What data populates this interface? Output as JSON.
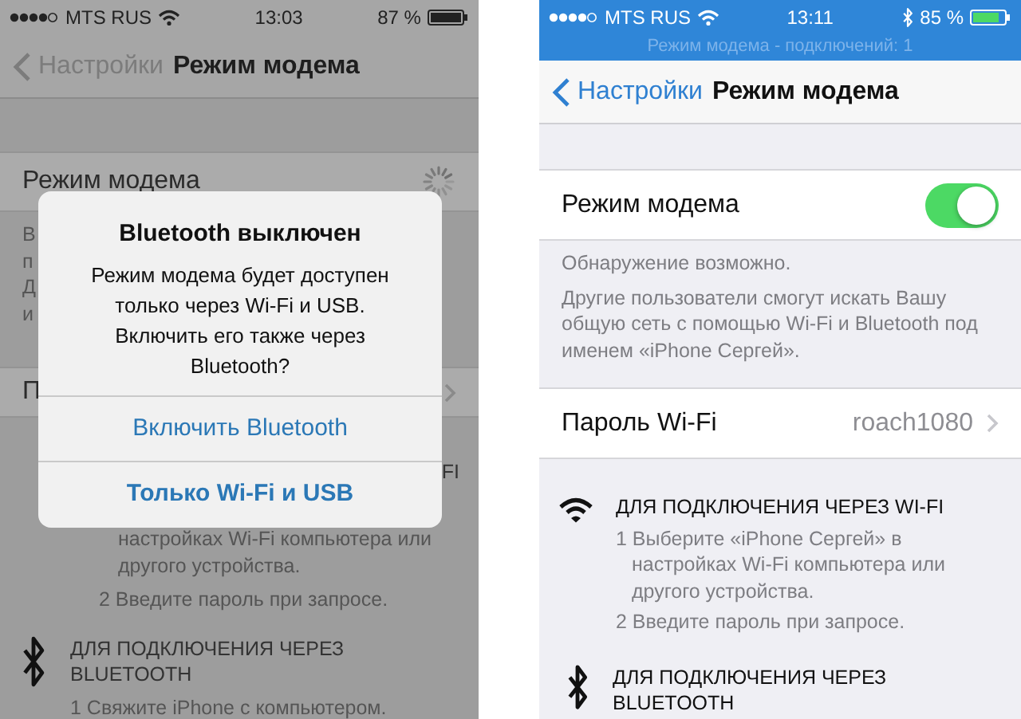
{
  "left_screen": {
    "status_bar": {
      "carrier": "MTS RUS",
      "time": "13:03",
      "battery": "87 %"
    },
    "nav": {
      "back": "Настройки",
      "title": "Режим модема"
    },
    "hotspot_row": {
      "label": "Режим модема",
      "loading": true
    },
    "description_fragments": [
      "В",
      "п",
      "Д",
      "и"
    ],
    "password_row": {
      "label": "П"
    },
    "wifi_section": {
      "title": "FI",
      "lines": [
        "настройках Wi-Fi компьютера или",
        "другого устройства.",
        "2 Введите пароль при запросе."
      ]
    },
    "bluetooth_section": {
      "title": "ДЛЯ ПОДКЛЮЧЕНИЯ ЧЕРЕЗ BLUETOOTH",
      "lines": [
        "1 Свяжите iPhone с компьютером."
      ]
    },
    "alert": {
      "title": "Bluetooth выключен",
      "message": "Режим модема будет доступен только через Wi-Fi и USB. Включить его также через Bluetooth?",
      "buttons": [
        {
          "label": "Включить Bluetooth",
          "bold": false
        },
        {
          "label": "Только Wi-Fi и USB",
          "bold": true
        }
      ]
    }
  },
  "right_screen": {
    "status_bar": {
      "carrier": "MTS RUS",
      "time": "13:11",
      "battery": "85 %",
      "banner": "Режим модема - подключений: 1"
    },
    "nav": {
      "back": "Настройки",
      "title": "Режим модема"
    },
    "hotspot_row": {
      "label": "Режим модема",
      "on": true
    },
    "description": [
      "Обнаружение возможно.",
      "Другие пользователи смогут искать Вашу общую сеть с помощью Wi-Fi и Bluetooth под именем «iPhone Сергей»."
    ],
    "password_row": {
      "label": "Пароль Wi-Fi",
      "value": "roach1080"
    },
    "wifi_section": {
      "title": "ДЛЯ ПОДКЛЮЧЕНИЯ ЧЕРЕЗ WI-FI",
      "lines": [
        "1 Выберите «iPhone Сергей» в настройках Wi-Fi компьютера или другого устройства.",
        "2 Введите пароль при запросе."
      ]
    },
    "bluetooth_section": {
      "title": "ДЛЯ ПОДКЛЮЧЕНИЯ ЧЕРЕЗ BLUETOOTH"
    }
  }
}
